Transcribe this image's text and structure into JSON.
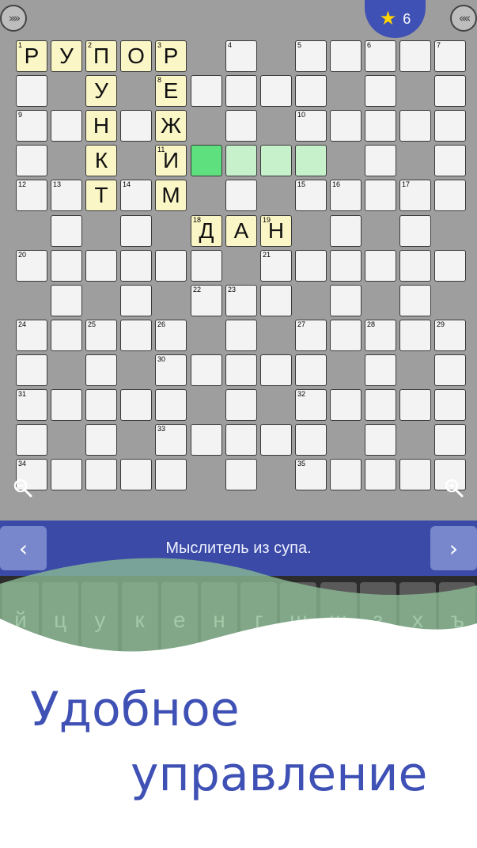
{
  "header": {
    "left_button_glyph": "»»",
    "right_button_glyph": "««",
    "stars_count": "6"
  },
  "grid": {
    "rows": [
      "PPPPPP.PP.PPPPPP.P",
      "........P.......P",
      "........",
      "........"
    ],
    "cells": [
      {
        "r": 0,
        "c": 0,
        "n": "1",
        "l": "Р",
        "s": "filled"
      },
      {
        "r": 0,
        "c": 1,
        "n": "",
        "l": "У",
        "s": "filled"
      },
      {
        "r": 0,
        "c": 2,
        "n": "2",
        "l": "П",
        "s": "filled"
      },
      {
        "r": 0,
        "c": 3,
        "n": "",
        "l": "О",
        "s": "filled"
      },
      {
        "r": 0,
        "c": 4,
        "n": "3",
        "l": "Р",
        "s": "filled"
      },
      {
        "r": 0,
        "c": 6,
        "n": "4",
        "l": "",
        "s": ""
      },
      {
        "r": 0,
        "c": 8,
        "n": "5",
        "l": "",
        "s": ""
      },
      {
        "r": 0,
        "c": 9,
        "n": "",
        "l": "",
        "s": ""
      },
      {
        "r": 0,
        "c": 10,
        "n": "6",
        "l": "",
        "s": ""
      },
      {
        "r": 0,
        "c": 11,
        "n": "",
        "l": "",
        "s": ""
      },
      {
        "r": 0,
        "c": 12,
        "n": "7",
        "l": "",
        "s": ""
      },
      {
        "r": 1,
        "c": 0,
        "n": "",
        "l": "",
        "s": ""
      },
      {
        "r": 1,
        "c": 2,
        "n": "",
        "l": "У",
        "s": "filled"
      },
      {
        "r": 1,
        "c": 4,
        "n": "8",
        "l": "Е",
        "s": "filled"
      },
      {
        "r": 1,
        "c": 5,
        "n": "",
        "l": "",
        "s": ""
      },
      {
        "r": 1,
        "c": 6,
        "n": "",
        "l": "",
        "s": ""
      },
      {
        "r": 1,
        "c": 7,
        "n": "",
        "l": "",
        "s": ""
      },
      {
        "r": 1,
        "c": 8,
        "n": "",
        "l": "",
        "s": ""
      },
      {
        "r": 1,
        "c": 10,
        "n": "",
        "l": "",
        "s": ""
      },
      {
        "r": 1,
        "c": 12,
        "n": "",
        "l": "",
        "s": ""
      },
      {
        "r": 2,
        "c": 0,
        "n": "9",
        "l": "",
        "s": ""
      },
      {
        "r": 2,
        "c": 1,
        "n": "",
        "l": "",
        "s": ""
      },
      {
        "r": 2,
        "c": 2,
        "n": "",
        "l": "Н",
        "s": "filled"
      },
      {
        "r": 2,
        "c": 3,
        "n": "",
        "l": "",
        "s": ""
      },
      {
        "r": 2,
        "c": 4,
        "n": "",
        "l": "Ж",
        "s": "filled"
      },
      {
        "r": 2,
        "c": 6,
        "n": "",
        "l": "",
        "s": ""
      },
      {
        "r": 2,
        "c": 8,
        "n": "10",
        "l": "",
        "s": ""
      },
      {
        "r": 2,
        "c": 9,
        "n": "",
        "l": "",
        "s": ""
      },
      {
        "r": 2,
        "c": 10,
        "n": "",
        "l": "",
        "s": ""
      },
      {
        "r": 2,
        "c": 11,
        "n": "",
        "l": "",
        "s": ""
      },
      {
        "r": 2,
        "c": 12,
        "n": "",
        "l": "",
        "s": ""
      },
      {
        "r": 3,
        "c": 0,
        "n": "",
        "l": "",
        "s": ""
      },
      {
        "r": 3,
        "c": 2,
        "n": "",
        "l": "К",
        "s": "filled"
      },
      {
        "r": 3,
        "c": 4,
        "n": "11",
        "l": "И",
        "s": "filled"
      },
      {
        "r": 3,
        "c": 5,
        "n": "",
        "l": "",
        "s": "cur"
      },
      {
        "r": 3,
        "c": 6,
        "n": "",
        "l": "",
        "s": "word"
      },
      {
        "r": 3,
        "c": 7,
        "n": "",
        "l": "",
        "s": "word"
      },
      {
        "r": 3,
        "c": 8,
        "n": "",
        "l": "",
        "s": "word"
      },
      {
        "r": 3,
        "c": 10,
        "n": "",
        "l": "",
        "s": ""
      },
      {
        "r": 3,
        "c": 12,
        "n": "",
        "l": "",
        "s": ""
      },
      {
        "r": 4,
        "c": 0,
        "n": "12",
        "l": "",
        "s": ""
      },
      {
        "r": 4,
        "c": 1,
        "n": "13",
        "l": "",
        "s": ""
      },
      {
        "r": 4,
        "c": 2,
        "n": "",
        "l": "Т",
        "s": "filled"
      },
      {
        "r": 4,
        "c": 3,
        "n": "14",
        "l": "",
        "s": ""
      },
      {
        "r": 4,
        "c": 4,
        "n": "",
        "l": "М",
        "s": "filled"
      },
      {
        "r": 4,
        "c": 6,
        "n": "",
        "l": "",
        "s": ""
      },
      {
        "r": 4,
        "c": 8,
        "n": "15",
        "l": "",
        "s": ""
      },
      {
        "r": 4,
        "c": 9,
        "n": "16",
        "l": "",
        "s": ""
      },
      {
        "r": 4,
        "c": 10,
        "n": "",
        "l": "",
        "s": ""
      },
      {
        "r": 4,
        "c": 11,
        "n": "17",
        "l": "",
        "s": ""
      },
      {
        "r": 4,
        "c": 12,
        "n": "",
        "l": "",
        "s": ""
      },
      {
        "r": 5,
        "c": 1,
        "n": "",
        "l": "",
        "s": ""
      },
      {
        "r": 5,
        "c": 3,
        "n": "",
        "l": "",
        "s": ""
      },
      {
        "r": 5,
        "c": 5,
        "n": "18",
        "l": "Д",
        "s": "filled"
      },
      {
        "r": 5,
        "c": 6,
        "n": "",
        "l": "А",
        "s": "filled"
      },
      {
        "r": 5,
        "c": 7,
        "n": "19",
        "l": "Н",
        "s": "filled"
      },
      {
        "r": 5,
        "c": 9,
        "n": "",
        "l": "",
        "s": ""
      },
      {
        "r": 5,
        "c": 11,
        "n": "",
        "l": "",
        "s": ""
      },
      {
        "r": 6,
        "c": 0,
        "n": "20",
        "l": "",
        "s": ""
      },
      {
        "r": 6,
        "c": 1,
        "n": "",
        "l": "",
        "s": ""
      },
      {
        "r": 6,
        "c": 2,
        "n": "",
        "l": "",
        "s": ""
      },
      {
        "r": 6,
        "c": 3,
        "n": "",
        "l": "",
        "s": ""
      },
      {
        "r": 6,
        "c": 4,
        "n": "",
        "l": "",
        "s": ""
      },
      {
        "r": 6,
        "c": 5,
        "n": "",
        "l": "",
        "s": ""
      },
      {
        "r": 6,
        "c": 7,
        "n": "21",
        "l": "",
        "s": ""
      },
      {
        "r": 6,
        "c": 8,
        "n": "",
        "l": "",
        "s": ""
      },
      {
        "r": 6,
        "c": 9,
        "n": "",
        "l": "",
        "s": ""
      },
      {
        "r": 6,
        "c": 10,
        "n": "",
        "l": "",
        "s": ""
      },
      {
        "r": 6,
        "c": 11,
        "n": "",
        "l": "",
        "s": ""
      },
      {
        "r": 6,
        "c": 12,
        "n": "",
        "l": "",
        "s": ""
      },
      {
        "r": 7,
        "c": 1,
        "n": "",
        "l": "",
        "s": ""
      },
      {
        "r": 7,
        "c": 3,
        "n": "",
        "l": "",
        "s": ""
      },
      {
        "r": 7,
        "c": 5,
        "n": "22",
        "l": "",
        "s": ""
      },
      {
        "r": 7,
        "c": 6,
        "n": "23",
        "l": "",
        "s": ""
      },
      {
        "r": 7,
        "c": 7,
        "n": "",
        "l": "",
        "s": ""
      },
      {
        "r": 7,
        "c": 9,
        "n": "",
        "l": "",
        "s": ""
      },
      {
        "r": 7,
        "c": 11,
        "n": "",
        "l": "",
        "s": ""
      },
      {
        "r": 8,
        "c": 0,
        "n": "24",
        "l": "",
        "s": ""
      },
      {
        "r": 8,
        "c": 1,
        "n": "",
        "l": "",
        "s": ""
      },
      {
        "r": 8,
        "c": 2,
        "n": "25",
        "l": "",
        "s": ""
      },
      {
        "r": 8,
        "c": 3,
        "n": "",
        "l": "",
        "s": ""
      },
      {
        "r": 8,
        "c": 4,
        "n": "26",
        "l": "",
        "s": ""
      },
      {
        "r": 8,
        "c": 6,
        "n": "",
        "l": "",
        "s": ""
      },
      {
        "r": 8,
        "c": 8,
        "n": "27",
        "l": "",
        "s": ""
      },
      {
        "r": 8,
        "c": 9,
        "n": "",
        "l": "",
        "s": ""
      },
      {
        "r": 8,
        "c": 10,
        "n": "28",
        "l": "",
        "s": ""
      },
      {
        "r": 8,
        "c": 11,
        "n": "",
        "l": "",
        "s": ""
      },
      {
        "r": 8,
        "c": 12,
        "n": "29",
        "l": "",
        "s": ""
      },
      {
        "r": 9,
        "c": 0,
        "n": "",
        "l": "",
        "s": ""
      },
      {
        "r": 9,
        "c": 2,
        "n": "",
        "l": "",
        "s": ""
      },
      {
        "r": 9,
        "c": 4,
        "n": "30",
        "l": "",
        "s": ""
      },
      {
        "r": 9,
        "c": 5,
        "n": "",
        "l": "",
        "s": ""
      },
      {
        "r": 9,
        "c": 6,
        "n": "",
        "l": "",
        "s": ""
      },
      {
        "r": 9,
        "c": 7,
        "n": "",
        "l": "",
        "s": ""
      },
      {
        "r": 9,
        "c": 8,
        "n": "",
        "l": "",
        "s": ""
      },
      {
        "r": 9,
        "c": 10,
        "n": "",
        "l": "",
        "s": ""
      },
      {
        "r": 9,
        "c": 12,
        "n": "",
        "l": "",
        "s": ""
      },
      {
        "r": 10,
        "c": 0,
        "n": "31",
        "l": "",
        "s": ""
      },
      {
        "r": 10,
        "c": 1,
        "n": "",
        "l": "",
        "s": ""
      },
      {
        "r": 10,
        "c": 2,
        "n": "",
        "l": "",
        "s": ""
      },
      {
        "r": 10,
        "c": 3,
        "n": "",
        "l": "",
        "s": ""
      },
      {
        "r": 10,
        "c": 4,
        "n": "",
        "l": "",
        "s": ""
      },
      {
        "r": 10,
        "c": 6,
        "n": "",
        "l": "",
        "s": ""
      },
      {
        "r": 10,
        "c": 8,
        "n": "32",
        "l": "",
        "s": ""
      },
      {
        "r": 10,
        "c": 9,
        "n": "",
        "l": "",
        "s": ""
      },
      {
        "r": 10,
        "c": 10,
        "n": "",
        "l": "",
        "s": ""
      },
      {
        "r": 10,
        "c": 11,
        "n": "",
        "l": "",
        "s": ""
      },
      {
        "r": 10,
        "c": 12,
        "n": "",
        "l": "",
        "s": ""
      },
      {
        "r": 11,
        "c": 0,
        "n": "",
        "l": "",
        "s": ""
      },
      {
        "r": 11,
        "c": 2,
        "n": "",
        "l": "",
        "s": ""
      },
      {
        "r": 11,
        "c": 4,
        "n": "33",
        "l": "",
        "s": ""
      },
      {
        "r": 11,
        "c": 5,
        "n": "",
        "l": "",
        "s": ""
      },
      {
        "r": 11,
        "c": 6,
        "n": "",
        "l": "",
        "s": ""
      },
      {
        "r": 11,
        "c": 7,
        "n": "",
        "l": "",
        "s": ""
      },
      {
        "r": 11,
        "c": 8,
        "n": "",
        "l": "",
        "s": ""
      },
      {
        "r": 11,
        "c": 10,
        "n": "",
        "l": "",
        "s": ""
      },
      {
        "r": 11,
        "c": 12,
        "n": "",
        "l": "",
        "s": ""
      },
      {
        "r": 12,
        "c": 0,
        "n": "34",
        "l": "",
        "s": ""
      },
      {
        "r": 12,
        "c": 1,
        "n": "",
        "l": "",
        "s": ""
      },
      {
        "r": 12,
        "c": 2,
        "n": "",
        "l": "",
        "s": ""
      },
      {
        "r": 12,
        "c": 3,
        "n": "",
        "l": "",
        "s": ""
      },
      {
        "r": 12,
        "c": 4,
        "n": "",
        "l": "",
        "s": ""
      },
      {
        "r": 12,
        "c": 6,
        "n": "",
        "l": "",
        "s": ""
      },
      {
        "r": 12,
        "c": 8,
        "n": "35",
        "l": "",
        "s": ""
      },
      {
        "r": 12,
        "c": 9,
        "n": "",
        "l": "",
        "s": ""
      },
      {
        "r": 12,
        "c": 10,
        "n": "",
        "l": "",
        "s": ""
      },
      {
        "r": 12,
        "c": 11,
        "n": "",
        "l": "",
        "s": ""
      },
      {
        "r": 12,
        "c": 12,
        "n": "",
        "l": "",
        "s": ""
      }
    ]
  },
  "clue": {
    "text": "Мыслитель из супа.",
    "prev_glyph": "‹",
    "next_glyph": "›"
  },
  "keyboard": {
    "keys": [
      "й",
      "ц",
      "у",
      "к",
      "е",
      "н",
      "г",
      "ш",
      "щ",
      "з",
      "х",
      "ъ"
    ]
  },
  "promo": {
    "line1": "Удобное",
    "line2": "управление"
  },
  "colors": {
    "board_bg": "#9e9e9e",
    "filled_cell": "#fbf6c5",
    "current_cell": "#5ee07e",
    "word_cell": "#c6f1cb",
    "accent": "#3f51b5",
    "clue_bar": "#3a4aa6",
    "wave": "#8cbd95"
  },
  "icons": {
    "zoom_out": "zoom-out-icon",
    "zoom_in": "zoom-in-icon",
    "star": "star-icon"
  }
}
